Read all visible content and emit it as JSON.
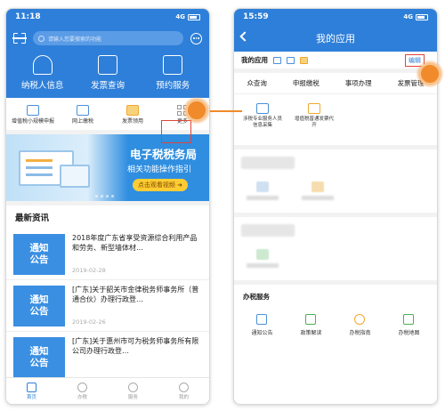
{
  "left": {
    "status_time": "11:18",
    "status_network": "4G",
    "search_placeholder": "请输入您要搜索的功能",
    "main_icons": [
      {
        "label": "纳税人信息",
        "icon": "person-card-icon"
      },
      {
        "label": "发票查询",
        "icon": "invoice-search-icon"
      },
      {
        "label": "预约服务",
        "icon": "calendar-icon"
      }
    ],
    "sub_icons": [
      {
        "label": "增值税小规模申报",
        "icon": "edit-form-icon",
        "color": "#4a90d9"
      },
      {
        "label": "网上缴税",
        "icon": "monitor-yen-icon",
        "color": "#4a90d9"
      },
      {
        "label": "发票领用",
        "icon": "layers-icon",
        "color": "#f0a830"
      },
      {
        "label": "更多",
        "icon": "grid-more-icon",
        "color": "#999999"
      }
    ],
    "banner": {
      "title": "电子税税务局",
      "subtitle": "相关功能操作指引",
      "button": "点击观看视频 ➜"
    },
    "news_title": "最新资讯",
    "news": [
      {
        "thumb_line1": "通知",
        "thumb_line2": "公告",
        "title": "2018年度广东省享受资源综合利用产品和劳务、新型墙体材…",
        "date": "2019-02-28"
      },
      {
        "thumb_line1": "通知",
        "thumb_line2": "公告",
        "title": "[广东]关于韶关市金律税务师事务所（普通合伙）办理行政登…",
        "date": "2019-02-26"
      },
      {
        "thumb_line1": "通知",
        "thumb_line2": "公告",
        "title": "[广东]关于惠州市可为税务师事务所有限公司办理行政登…",
        "date": ""
      }
    ],
    "tabs": [
      {
        "label": "首页",
        "active": true
      },
      {
        "label": "办税",
        "active": false
      },
      {
        "label": "服务",
        "active": false
      },
      {
        "label": "我的",
        "active": false
      }
    ]
  },
  "right": {
    "status_time": "15:59",
    "status_network": "4G",
    "nav_title": "我的应用",
    "my_apps_label": "我的应用",
    "edit_label": "编辑",
    "category_tabs": [
      "众查询",
      "申报缴税",
      "事项办理",
      "发票管理"
    ],
    "apps": [
      {
        "label": "涉税专业服务人员信息采集",
        "icon": "id-card-icon"
      },
      {
        "label": "增值税普通发票代开",
        "icon": "invoice-edit-icon"
      }
    ],
    "tax_service_title": "办税服务",
    "services": [
      {
        "label": "通知公告",
        "icon": "megaphone-icon"
      },
      {
        "label": "政策解读",
        "icon": "document-icon"
      },
      {
        "label": "办税指南",
        "icon": "compass-icon"
      },
      {
        "label": "办税地图",
        "icon": "map-pin-icon"
      }
    ]
  },
  "colors": {
    "brand_blue": "#2e7fd9",
    "highlight_orange": "#f08a2a",
    "highlight_red": "#e0453a"
  }
}
